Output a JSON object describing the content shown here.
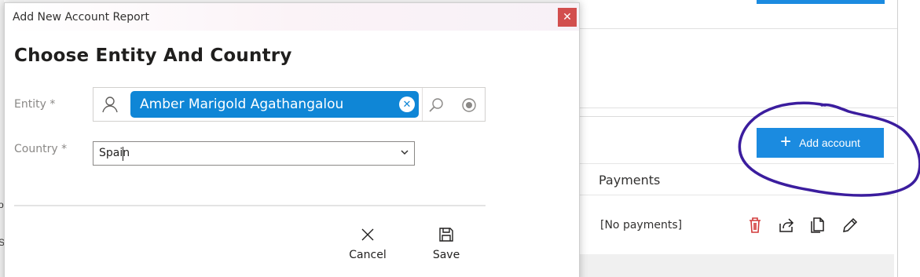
{
  "dialog": {
    "window_title": "Add New Account Report",
    "close_glyph": "✕",
    "heading": "Choose Entity And Country",
    "entity_label": "Entity *",
    "entity_value": "Amber Marigold Agathangalou",
    "country_label": "Country *",
    "country_value": "Spain",
    "cancel_label": "Cancel",
    "save_label": "Save",
    "icons": [
      "person-icon",
      "remove-tag-icon",
      "search-icon",
      "target-icon",
      "chevron-down-icon",
      "close-x-icon",
      "save-disk-icon"
    ]
  },
  "background": {
    "add_account_label": "Add account",
    "payments_header": "Payments",
    "no_payments_text": "[No payments]",
    "row_icons": [
      "delete-icon",
      "share-icon",
      "copy-icon",
      "edit-icon"
    ],
    "left_fragment_1": "o",
    "left_fragment_2": "S"
  },
  "colors": {
    "accent": "#1b8be0",
    "tag": "#0f86d6",
    "close_button": "#d24e4e",
    "delete_icon": "#d23a3a",
    "highlight": "#ffef00",
    "annotation_circle": "#3b1d9e"
  }
}
